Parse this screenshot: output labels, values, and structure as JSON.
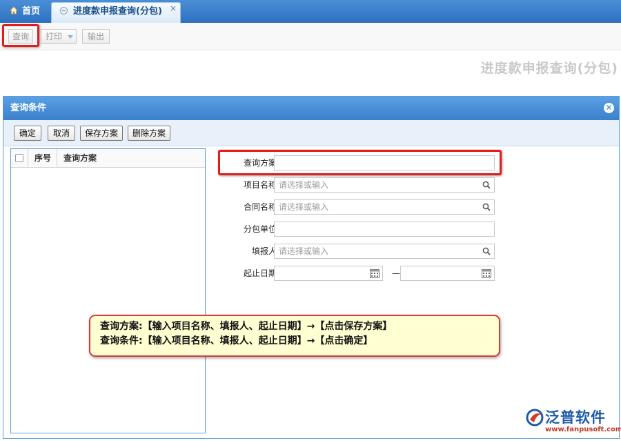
{
  "tabs": {
    "home_label": "首页",
    "active_label": "进度款申报查询(分包)",
    "close_glyph": "×"
  },
  "toolbar": {
    "query_label": "查询",
    "print_label": "打印",
    "export_label": "输出"
  },
  "page": {
    "title": "进度款申报查询(分包)"
  },
  "dialog": {
    "title": "查询条件",
    "close_glyph": "✕",
    "buttons": {
      "confirm": "确定",
      "cancel": "取消",
      "save_scheme": "保存方案",
      "delete_scheme": "删除方案"
    },
    "scheme_list": {
      "col_index": "序号",
      "col_scheme": "查询方案"
    },
    "form": {
      "scheme": {
        "label": "查询方案:",
        "value": ""
      },
      "project": {
        "label": "项目名称:",
        "placeholder": "请选择或输入"
      },
      "contract": {
        "label": "合同名称:",
        "placeholder": "请选择或输入"
      },
      "subcontractor": {
        "label": "分包单位:",
        "value": ""
      },
      "reporter": {
        "label": "填报人:",
        "placeholder": "请选择或输入"
      },
      "date_range": {
        "label": "起止日期:",
        "separator": "—",
        "start": "",
        "end": ""
      }
    }
  },
  "callout": {
    "line1": "查询方案:【输入项目名称、填报人、起止日期】→【点击保存方案】",
    "line2": "查询条件:【输入项目名称、填报人、起止日期】→【点击确定】"
  },
  "logo": {
    "name": "泛普软件",
    "url": "www.fanpusoft.com",
    "icon": "fanpu-logo-icon"
  },
  "colors": {
    "accent_blue": "#3a80cc",
    "highlight_red": "#e21b1b",
    "callout_bg": "#ffffd2"
  }
}
